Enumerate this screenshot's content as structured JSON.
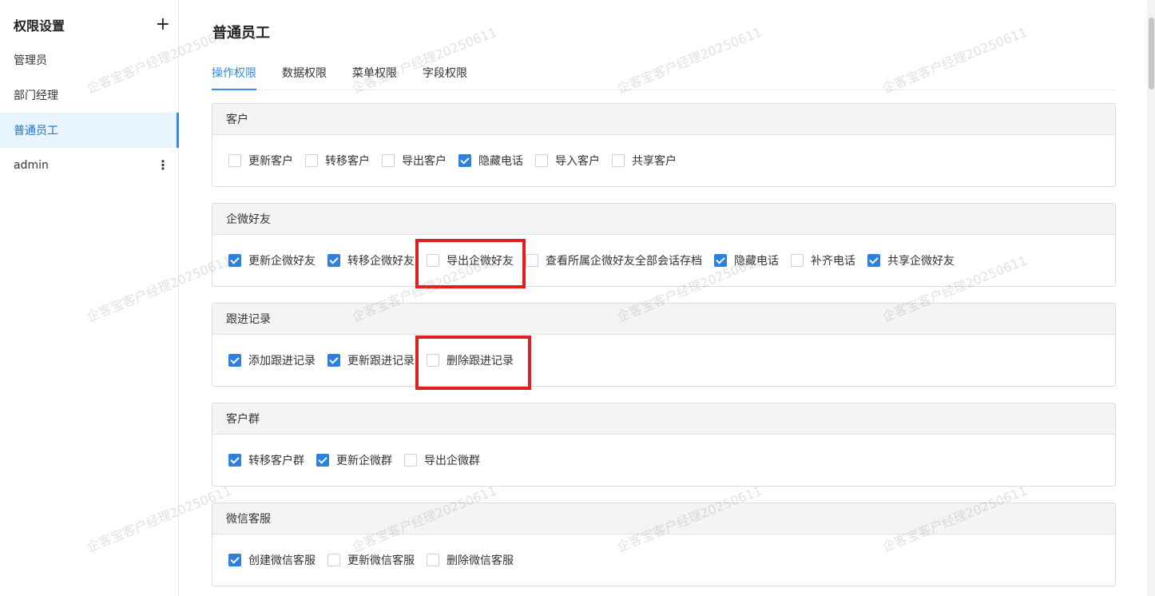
{
  "sidebar": {
    "title": "权限设置",
    "add_icon": "plus-icon",
    "items": [
      {
        "label": "管理员"
      },
      {
        "label": "部门经理"
      },
      {
        "label": "普通员工"
      },
      {
        "label": "admin"
      }
    ],
    "more_icon": "more-vertical-icon"
  },
  "main": {
    "title": "普通员工",
    "tabs": [
      {
        "label": "操作权限"
      },
      {
        "label": "数据权限"
      },
      {
        "label": "菜单权限"
      },
      {
        "label": "字段权限"
      }
    ],
    "sections": [
      {
        "title": "客户",
        "items": [
          {
            "label": "更新客户",
            "checked": false
          },
          {
            "label": "转移客户",
            "checked": false
          },
          {
            "label": "导出客户",
            "checked": false
          },
          {
            "label": "隐藏电话",
            "checked": true
          },
          {
            "label": "导入客户",
            "checked": false
          },
          {
            "label": "共享客户",
            "checked": false
          }
        ]
      },
      {
        "title": "企微好友",
        "items": [
          {
            "label": "更新企微好友",
            "checked": true
          },
          {
            "label": "转移企微好友",
            "checked": true
          },
          {
            "label": "导出企微好友",
            "checked": false
          },
          {
            "label": "查看所属企微好友全部会话存档",
            "checked": false
          },
          {
            "label": "隐藏电话",
            "checked": true
          },
          {
            "label": "补齐电话",
            "checked": false
          },
          {
            "label": "共享企微好友",
            "checked": true
          }
        ]
      },
      {
        "title": "跟进记录",
        "items": [
          {
            "label": "添加跟进记录",
            "checked": true
          },
          {
            "label": "更新跟进记录",
            "checked": true
          },
          {
            "label": "删除跟进记录",
            "checked": false
          }
        ]
      },
      {
        "title": "客户群",
        "items": [
          {
            "label": "转移客户群",
            "checked": true
          },
          {
            "label": "更新企微群",
            "checked": true
          },
          {
            "label": "导出企微群",
            "checked": false
          }
        ]
      },
      {
        "title": "微信客服",
        "items": [
          {
            "label": "创建微信客服",
            "checked": true
          },
          {
            "label": "更新微信客服",
            "checked": false
          },
          {
            "label": "删除微信客服",
            "checked": false
          }
        ]
      }
    ]
  },
  "watermark": "企客宝客户经理20250611",
  "colors": {
    "accent": "#2d8cf0",
    "checked": "#2d7fe0",
    "highlight": "#e02020"
  }
}
